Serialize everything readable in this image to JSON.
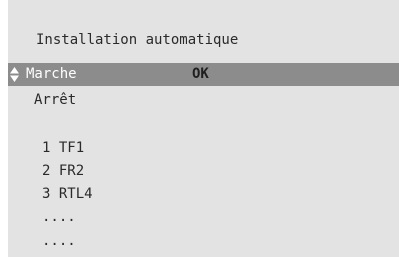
{
  "menu": {
    "title": "Installation automatique",
    "options": [
      {
        "label": "Marche",
        "status": "OK",
        "selected": true
      },
      {
        "label": "Arrêt",
        "selected": false
      }
    ],
    "channels": [
      "1 TF1",
      "2 FR2",
      "3 RTL4",
      "....",
      "...."
    ]
  },
  "icons": {
    "selector": "up-down-arrows-icon"
  },
  "colors": {
    "background": "#e3e3e3",
    "highlight": "#8c8c8c",
    "text": "#2a2a2a",
    "highlight_text": "#ffffff"
  }
}
